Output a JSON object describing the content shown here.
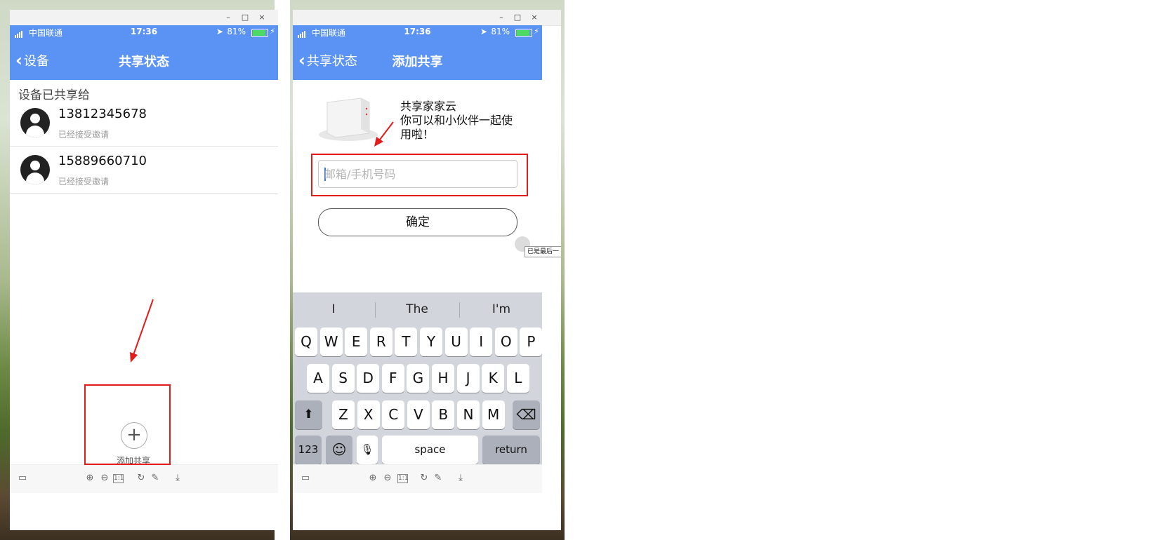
{
  "status_bar": {
    "carrier": "中国联通",
    "time": "17:36",
    "battery": "81%"
  },
  "window_controls": {
    "minimize": "–",
    "maximize": "□",
    "close": "×"
  },
  "left_screen": {
    "back_label": "设备",
    "title": "共享状态",
    "section_title": "设备已共享给",
    "shared_users": [
      {
        "phone": "13812345678",
        "status": "已经接受邀请"
      },
      {
        "phone": "15889660710",
        "status": "已经接受邀请"
      }
    ],
    "add_share_icon": "+",
    "add_share_label": "添加共享"
  },
  "right_screen": {
    "back_label": "共享状态",
    "title": "添加共享",
    "share_text": [
      "共享家家云",
      "你可以和小伙伴一起使",
      "用啦！"
    ],
    "input_placeholder": "邮箱/手机号码",
    "confirm_label": "确定",
    "tooltip": "已是最后一"
  },
  "keyboard": {
    "suggestions": [
      "I",
      "The",
      "I'm"
    ],
    "row1": [
      "Q",
      "W",
      "E",
      "R",
      "T",
      "Y",
      "U",
      "I",
      "O",
      "P"
    ],
    "row2": [
      "A",
      "S",
      "D",
      "F",
      "G",
      "H",
      "J",
      "K",
      "L"
    ],
    "row3": [
      "Z",
      "X",
      "C",
      "V",
      "B",
      "N",
      "M"
    ],
    "shift": "⬆",
    "delete": "⌫",
    "numbers": "123",
    "emoji": "☺",
    "mic": "🎙",
    "space": "space",
    "return": "return"
  },
  "toolbar_icons": {
    "panel": "▭",
    "zoom_in": "⊕",
    "zoom_out": "⊖",
    "actual_size": "1:1",
    "rotate": "↻",
    "edit": "✎",
    "download": "⤓"
  },
  "colors": {
    "nav_blue": "#5b93f4",
    "annotation_red": "#e21b1b"
  }
}
